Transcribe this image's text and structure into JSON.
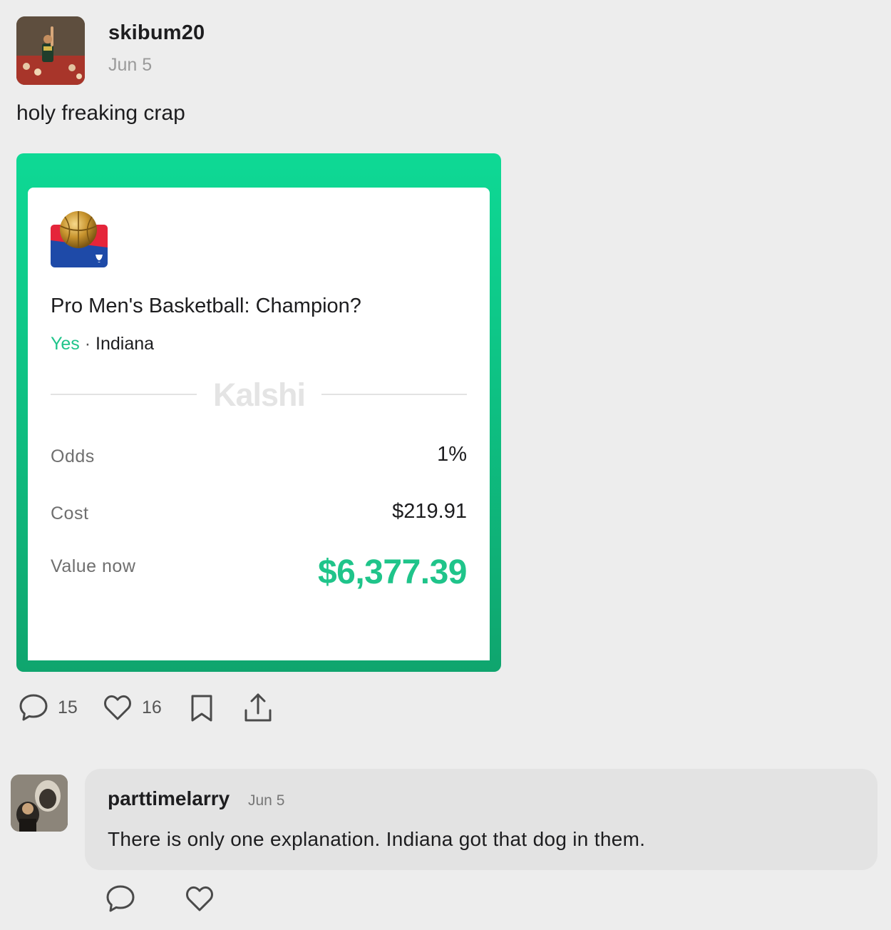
{
  "post": {
    "username": "skibum20",
    "date": "Jun 5",
    "text": "holy freaking crap"
  },
  "card": {
    "market_title": "Pro Men's Basketball: Champion?",
    "outcome": "Yes",
    "separator": "·",
    "team": "Indiana",
    "brand": "Kalshi",
    "odds_label": "Odds",
    "odds_value": "1%",
    "cost_label": "Cost",
    "cost_value": "$219.91",
    "value_label": "Value now",
    "value_value": "$6,377.39",
    "colors": {
      "accent_green": "#1fc48a",
      "card_gradient_top": "#0ed995",
      "card_gradient_bottom": "#0fa56e"
    }
  },
  "actions": {
    "comment_count": "15",
    "like_count": "16",
    "icons": [
      "comment-icon",
      "heart-icon",
      "bookmark-icon",
      "share-icon"
    ]
  },
  "comment": {
    "username": "parttimelarry",
    "date": "Jun 5",
    "text": "There is only one explanation. Indiana got that dog in them.",
    "icons": [
      "reply-icon",
      "heart-icon"
    ]
  }
}
